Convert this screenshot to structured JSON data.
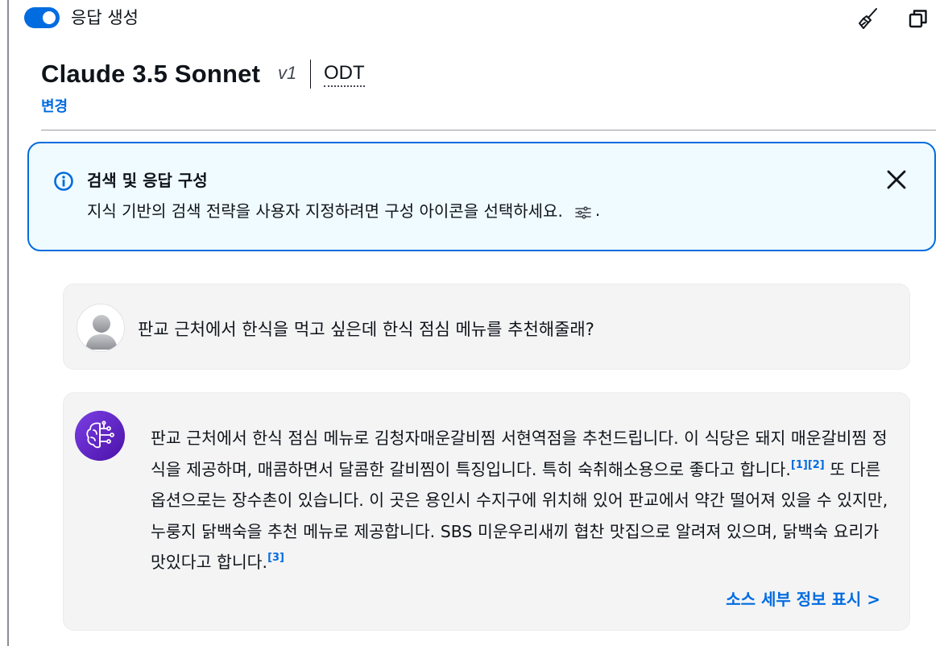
{
  "header": {
    "toggle_label": "응답 생성",
    "toggle_on": true,
    "accent_color": "#006ce0"
  },
  "toolbar": {
    "icons": [
      "broom-icon",
      "copy-icon"
    ]
  },
  "model": {
    "name": "Claude 3.5 Sonnet",
    "version": "v1",
    "mode": "ODT",
    "change_label": "변경"
  },
  "alert": {
    "icon": "info-icon",
    "title": "검색 및 응답 구성",
    "body": "지식 기반의 검색 전략을 사용자 지정하려면 구성 아이콘을 선택하세요.",
    "body_end": ".",
    "inline_icon": "settings-sliders-icon",
    "close_icon": "close-icon"
  },
  "chat": {
    "user_message": "판교 근처에서 한식을 먹고 싶은데 한식 점심 메뉴를 추천해줄래?",
    "bot": {
      "part1": "판교 근처에서 한식 점심 메뉴로 김청자매운갈비찜 서현역점을 추천드립니다. 이 식당은 돼지 매운갈비찜 정식을 제공하며, 매콤하면서 달콤한 갈비찜이 특징입니다. 특히 숙취해소용으로 좋다고 합니다.",
      "cite1": "[1]",
      "cite2": "[2]",
      "part2": " 또 다른 옵션으로는 장수촌이 있습니다. 이 곳은 용인시 수지구에 위치해 있어 판교에서 약간 떨어져 있을 수 있지만, 누룽지 닭백숙을 추천 메뉴로 제공합니다. SBS 미운우리새끼 협찬 맛집으로 알려져 있으며, 닭백숙 요리가 맛있다고 합니다.",
      "cite3": "[3]",
      "source_link": "소스 세부 정보 표시 >"
    }
  }
}
